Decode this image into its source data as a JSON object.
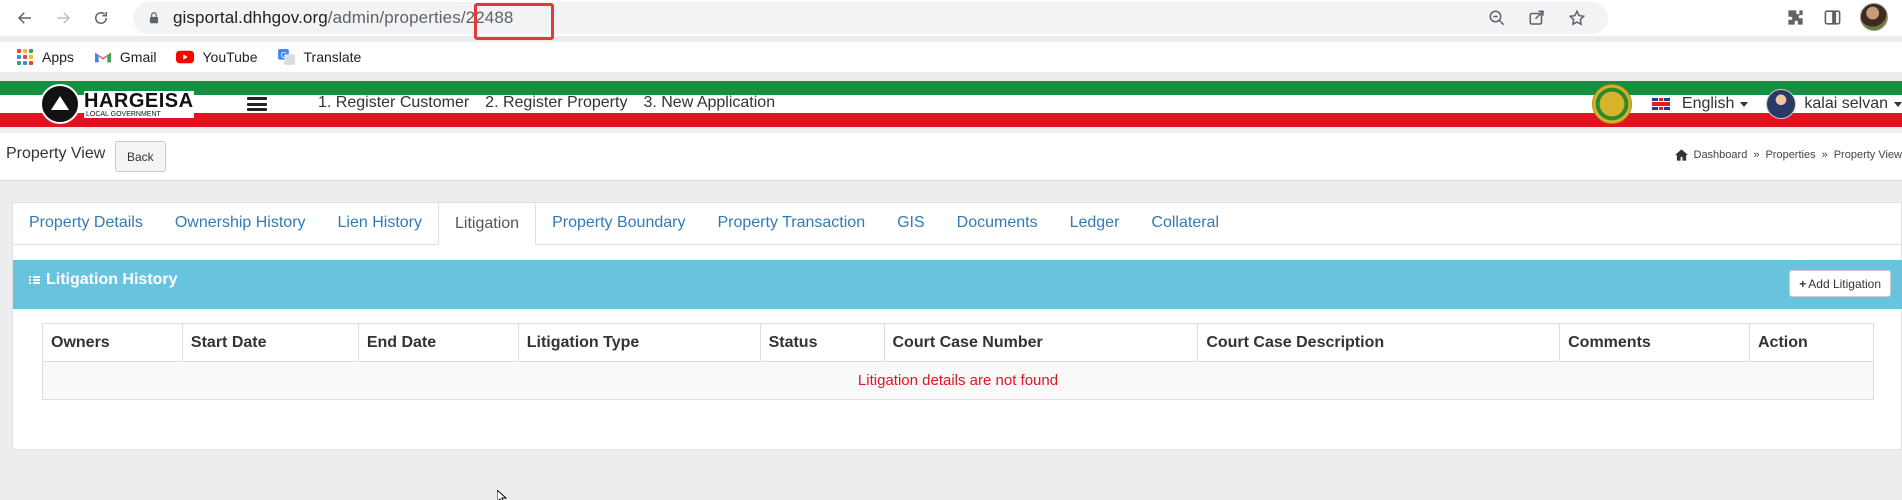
{
  "browser": {
    "url_host": "gisportal.dhhgov.org",
    "url_path": "/admin/properties/",
    "url_id": "22488"
  },
  "bookmarks": [
    {
      "label": "Apps",
      "icon": "apps-grid-icon"
    },
    {
      "label": "Gmail",
      "icon": "gmail-icon"
    },
    {
      "label": "YouTube",
      "icon": "youtube-icon"
    },
    {
      "label": "Translate",
      "icon": "translate-icon"
    }
  ],
  "header": {
    "logo_title": "HARGEISA",
    "logo_subtitle": "LOCAL GOVERNMENT",
    "nav": [
      {
        "label": "1. Register Customer"
      },
      {
        "label": "2. Register Property"
      },
      {
        "label": "3. New Application"
      }
    ],
    "language": "English",
    "user_name": "kalai selvan"
  },
  "page": {
    "title": "Property View",
    "back_label": "Back",
    "breadcrumb": [
      "Dashboard",
      "Properties",
      "Property View"
    ]
  },
  "tabs": [
    {
      "label": "Property Details",
      "active": false
    },
    {
      "label": "Ownership History",
      "active": false
    },
    {
      "label": "Lien History",
      "active": false
    },
    {
      "label": "Litigation",
      "active": true
    },
    {
      "label": "Property Boundary",
      "active": false
    },
    {
      "label": "Property Transaction",
      "active": false
    },
    {
      "label": "GIS",
      "active": false
    },
    {
      "label": "Documents",
      "active": false
    },
    {
      "label": "Ledger",
      "active": false
    },
    {
      "label": "Collateral",
      "active": false
    }
  ],
  "litigation": {
    "title": "Litigation History",
    "add_label": "Add Litigation",
    "columns": [
      "Owners",
      "Start Date",
      "End Date",
      "Litigation Type",
      "Status",
      "Court Case Number",
      "Court Case Description",
      "Comments",
      "Action"
    ],
    "empty_message": "Litigation details are not found"
  },
  "colors": {
    "stripe_green": "#149040",
    "stripe_red": "#e0141e",
    "box_header": "#68c3de",
    "link": "#337ab7",
    "url_highlight": "#e03a3a"
  }
}
